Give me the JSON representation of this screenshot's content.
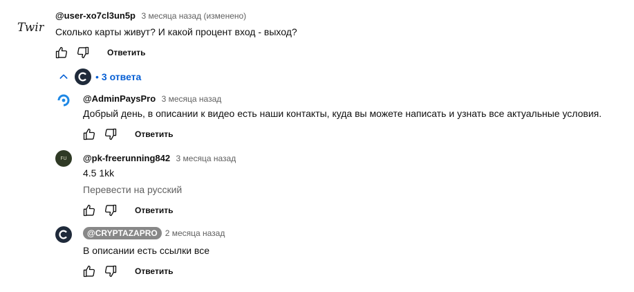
{
  "main_comment": {
    "author": "@user-xo7cl3un5p",
    "meta": "3 месяца назад (изменено)",
    "text": "Сколько карты живут? И какой процент вход - выход?",
    "reply_label": "Ответить",
    "avatar_logo": "Twird"
  },
  "replies_toggle": {
    "label": "3 ответа",
    "bullet": "•"
  },
  "replies": [
    {
      "author": "@AdminPaysPro",
      "meta": "3 месяца назад",
      "text": "Добрый день, в описании к видео есть наши контакты, куда вы можете написать и узнать все актуальные условия.",
      "reply_label": "Ответить"
    },
    {
      "author": "@pk-freerunning842",
      "meta": "3 месяца назад",
      "text": "4.5 1kk",
      "translate_label": "Перевести на русский",
      "reply_label": "Ответить",
      "avatar_text": "FU"
    },
    {
      "author": "@CRYPTAZAPRO",
      "meta": "2 месяца назад",
      "text": "В описании есть ссылки все",
      "reply_label": "Ответить"
    }
  ],
  "colors": {
    "link_blue": "#065fd4",
    "meta_gray": "#606060",
    "badge_gray": "#888888",
    "admin_blue": "#1e88e5",
    "crypt_dark": "#1f2a3a"
  }
}
